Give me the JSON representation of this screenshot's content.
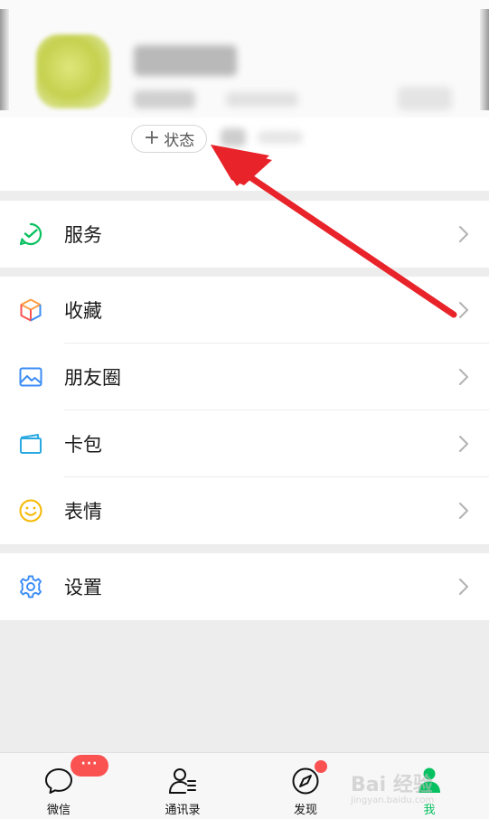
{
  "profile": {
    "status_plus": "+",
    "status_label": "状态"
  },
  "menu": {
    "services": {
      "label": "服务",
      "icon": "services-icon"
    },
    "favorites": {
      "label": "收藏",
      "icon": "favorites-cube-icon"
    },
    "moments": {
      "label": "朋友圈",
      "icon": "moments-image-icon"
    },
    "cards": {
      "label": "卡包",
      "icon": "card-wallet-icon"
    },
    "stickers": {
      "label": "表情",
      "icon": "smiley-icon"
    },
    "settings": {
      "label": "设置",
      "icon": "gear-icon"
    }
  },
  "tabbar": {
    "chats": {
      "label": "微信",
      "badge": "···"
    },
    "contacts": {
      "label": "通讯录"
    },
    "discover": {
      "label": "发现"
    },
    "me": {
      "label": "我"
    }
  },
  "watermark": {
    "line1": "Bai 经验",
    "line2": "jingyan.baidu.com"
  },
  "colors": {
    "accent_green": "#07c160",
    "badge_red": "#fa5151",
    "annotation_arrow": "#e8232a",
    "background": "#ededed"
  }
}
